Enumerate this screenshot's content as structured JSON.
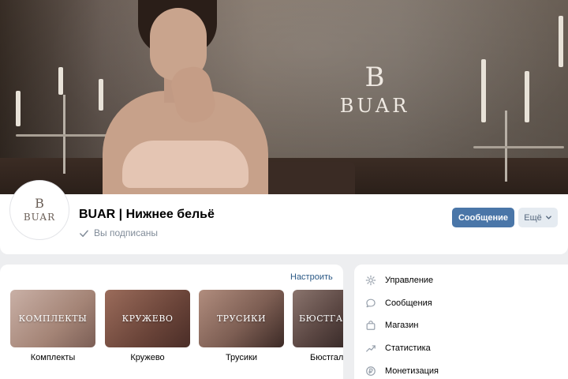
{
  "cover": {
    "brand_monogram": "B",
    "brand_word": "BUAR"
  },
  "profile": {
    "avatar_monogram": "B",
    "avatar_word": "BUAR",
    "title": "BUAR | Нижнее бельё",
    "status": "Вы подписаны",
    "message_button": "Сообщение",
    "more_button": "Ещё"
  },
  "collections": {
    "setup_link": "Настроить",
    "items": [
      {
        "overlay": "КОМПЛЕКТЫ",
        "caption": "Комплекты",
        "color": "#b0958a"
      },
      {
        "overlay": "КРУЖЕВО",
        "caption": "Кружево",
        "color": "#7a5448"
      },
      {
        "overlay": "ТРУСИКИ",
        "caption": "Трусики",
        "color": "#8c6a5e"
      },
      {
        "overlay": "БЮСТГАЛ",
        "caption": "Бюстгал",
        "color": "#6f5a55"
      }
    ]
  },
  "menu": {
    "items": [
      {
        "label": "Управление",
        "icon": "gear-icon"
      },
      {
        "label": "Сообщения",
        "icon": "chat-bubble-icon"
      },
      {
        "label": "Магазин",
        "icon": "shopping-bag-icon"
      },
      {
        "label": "Статистика",
        "icon": "trend-chart-icon"
      },
      {
        "label": "Монетизация",
        "icon": "ruble-coin-icon"
      }
    ]
  },
  "colors": {
    "accent": "#4a76a8",
    "link": "#2a5885",
    "muted_text": "#818c99",
    "page_background": "#edeef0"
  }
}
